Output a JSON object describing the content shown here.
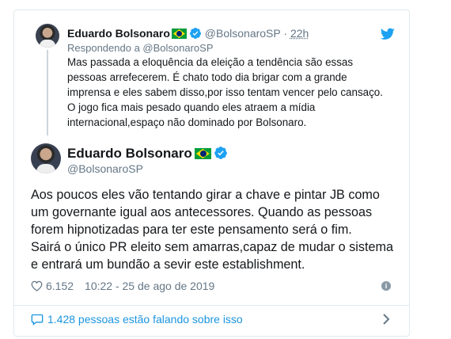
{
  "parent_tweet": {
    "name": "Eduardo Bolsonaro",
    "handle": "@BolsonaroSP",
    "separator": "·",
    "time": "22h",
    "replying_to": "Respondendo a @BolsonaroSP",
    "text_lines": [
      "Mas passada a eloquência da eleição a tendência são essas",
      "pessoas arrefecerem. É chato todo dia brigar com a grande",
      "imprensa e eles sabem disso,por isso tentam vencer pelo cansaço.",
      "O jogo fica mais pesado quando eles atraem a mídia",
      "internacional,espaço não dominado por Bolsonaro."
    ]
  },
  "main_tweet": {
    "name": "Eduardo Bolsonaro",
    "handle": "@BolsonaroSP",
    "text_lines": [
      "Aos poucos eles vão tentando girar a chave e pintar JB como",
      "um governante igual aos antecessores. Quando as pessoas",
      "forem hipnotizadas para ter este pensamento será o fim.",
      "Sairá o único PR eleito sem amarras,capaz de mudar o sistema",
      "e entrará um bundão a sevir este establishment."
    ],
    "likes": "6.152",
    "timestamp": "10:22 - 25 de ago de 2019"
  },
  "footer": {
    "talking": "1.428 pessoas estão falando sobre isso"
  },
  "colors": {
    "twitter_blue": "#1da1f2",
    "link_blue": "#1b95e0",
    "secondary_text": "#657786",
    "border": "#e1e8ed"
  },
  "icons": [
    "verified-icon",
    "brazil-flag-icon",
    "twitter-bird-icon",
    "heart-icon",
    "info-icon",
    "comment-bubble-icon",
    "chevron-right-icon"
  ]
}
